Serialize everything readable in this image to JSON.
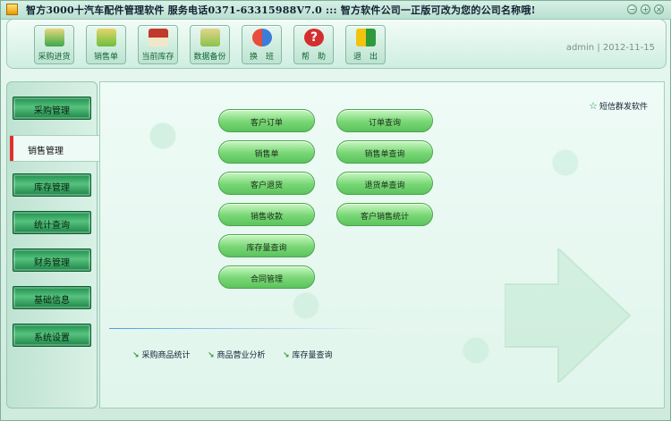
{
  "window": {
    "title": "智方3000十汽车配件管理软件   服务电话0371-63315988V7.0 ::: 智方软件公司一正版可改为您的公司名称哦!",
    "controls": [
      "minimize",
      "maximize",
      "close"
    ]
  },
  "toolbar": {
    "buttons": [
      {
        "label": "采购进货",
        "icon": "box-icon",
        "color": "#4caf50"
      },
      {
        "label": "销售单",
        "icon": "box-sell-icon",
        "color": "#6cbf3d"
      },
      {
        "label": "当前库存",
        "icon": "house-icon",
        "color": "#c0392b"
      },
      {
        "label": "数据备份",
        "icon": "backup-icon",
        "color": "#8bc34a"
      },
      {
        "label": "换　班",
        "icon": "users-icon",
        "color": "#e74c3c"
      },
      {
        "label": "帮　助",
        "icon": "help-icon",
        "color": "#d32f2f"
      },
      {
        "label": "退　出",
        "icon": "exit-icon",
        "color": "#f1c40f"
      }
    ],
    "user": "admin | 2012-11-15"
  },
  "sidebar": {
    "items": [
      {
        "label": "采购管理"
      },
      {
        "label": "销售管理",
        "active": true
      },
      {
        "label": "库存管理"
      },
      {
        "label": "统计查询"
      },
      {
        "label": "财务管理"
      },
      {
        "label": "基础信息"
      },
      {
        "label": "系统设置"
      }
    ]
  },
  "main": {
    "sms_link": "短信群发软件",
    "left_buttons": [
      "客户订单",
      "销售单",
      "客户退货",
      "销售收款",
      "库存量查询",
      "合同管理"
    ],
    "right_buttons": [
      "订单查询",
      "销售单查询",
      "退货单查询",
      "客户销售统计"
    ],
    "quick_links": [
      "采购商品统计",
      "商品营业分析",
      "库存量查询"
    ]
  }
}
